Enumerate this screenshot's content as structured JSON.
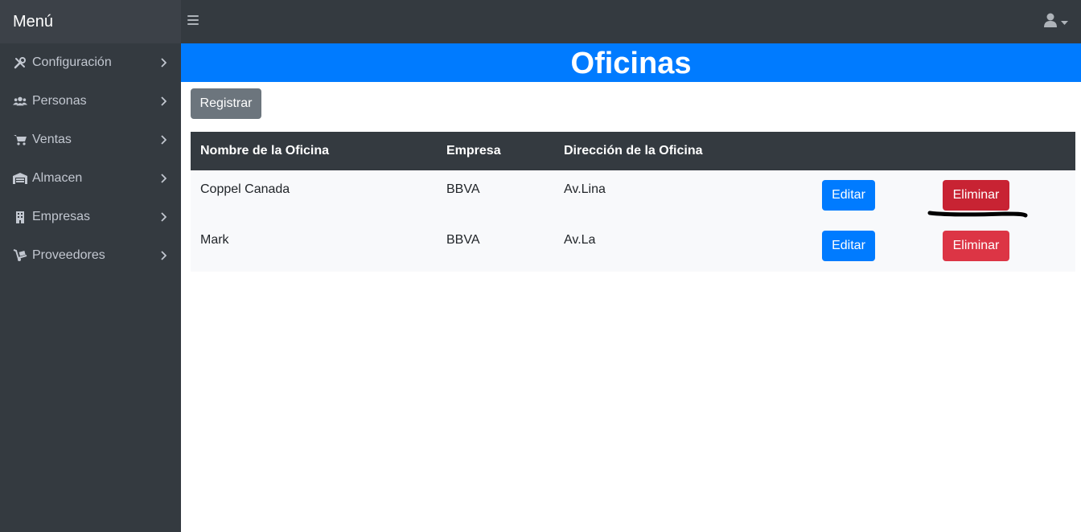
{
  "sidebar": {
    "brand": "Menú",
    "items": [
      {
        "label": "Configuración",
        "icon": "tools-icon"
      },
      {
        "label": "Personas",
        "icon": "users-icon"
      },
      {
        "label": "Ventas",
        "icon": "cart-icon"
      },
      {
        "label": "Almacen",
        "icon": "warehouse-icon"
      },
      {
        "label": "Empresas",
        "icon": "building-icon"
      },
      {
        "label": "Proveedores",
        "icon": "dolly-icon"
      }
    ]
  },
  "header": {
    "menu_icon": "hamburger-icon",
    "user_icon": "user-icon"
  },
  "page": {
    "title": "Oficinas",
    "register_label": "Registrar"
  },
  "table": {
    "columns": [
      "Nombre de la Oficina",
      "Empresa",
      "Dirección de la Oficina"
    ],
    "rows": [
      {
        "nombre": "Coppel Canada",
        "empresa": "BBVA",
        "direccion": "Av.Lina",
        "edit_label": "Editar",
        "delete_label": "Eliminar"
      },
      {
        "nombre": "Mark",
        "empresa": "BBVA",
        "direccion": "Av.La",
        "edit_label": "Editar",
        "delete_label": "Eliminar"
      }
    ]
  },
  "colors": {
    "sidebar_bg": "#343a40",
    "primary": "#007bff",
    "danger": "#dc3545",
    "secondary": "#6c757d"
  }
}
